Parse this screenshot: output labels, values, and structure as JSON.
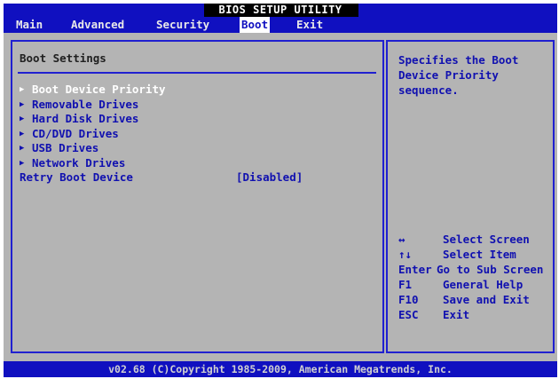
{
  "title": "BIOS SETUP UTILITY",
  "menu": [
    {
      "label": "Main",
      "active": false
    },
    {
      "label": "Advanced",
      "active": false
    },
    {
      "label": "Security",
      "active": false
    },
    {
      "label": "Boot",
      "active": true
    },
    {
      "label": "Exit",
      "active": false
    }
  ],
  "main": {
    "section_title": "Boot Settings",
    "items": [
      {
        "label": "Boot Device Priority",
        "selected": true
      },
      {
        "label": "Removable Drives",
        "selected": false
      },
      {
        "label": "Hard Disk Drives",
        "selected": false
      },
      {
        "label": "CD/DVD Drives",
        "selected": false
      },
      {
        "label": "USB Drives",
        "selected": false
      },
      {
        "label": "Network Drives",
        "selected": false
      }
    ],
    "retry": {
      "label": "Retry Boot Device",
      "value": "[Disabled]"
    }
  },
  "help": {
    "description": "Specifies the Boot Device Priority sequence.",
    "keys": [
      {
        "key": "↔",
        "action": "Select Screen"
      },
      {
        "key": "↑↓",
        "action": "Select Item"
      },
      {
        "key": "Enter",
        "action": "Go to Sub Screen"
      },
      {
        "key": "F1",
        "action": "General Help"
      },
      {
        "key": "F10",
        "action": "Save and Exit"
      },
      {
        "key": "ESC",
        "action": "Exit"
      }
    ]
  },
  "footer": "v02.68 (C)Copyright 1985-2009, American Megatrends, Inc.",
  "colors": {
    "background": "#b4b4b4",
    "bar_blue": "#1010c0",
    "text_blue": "#1010b0",
    "selected_text": "#ffffff"
  }
}
